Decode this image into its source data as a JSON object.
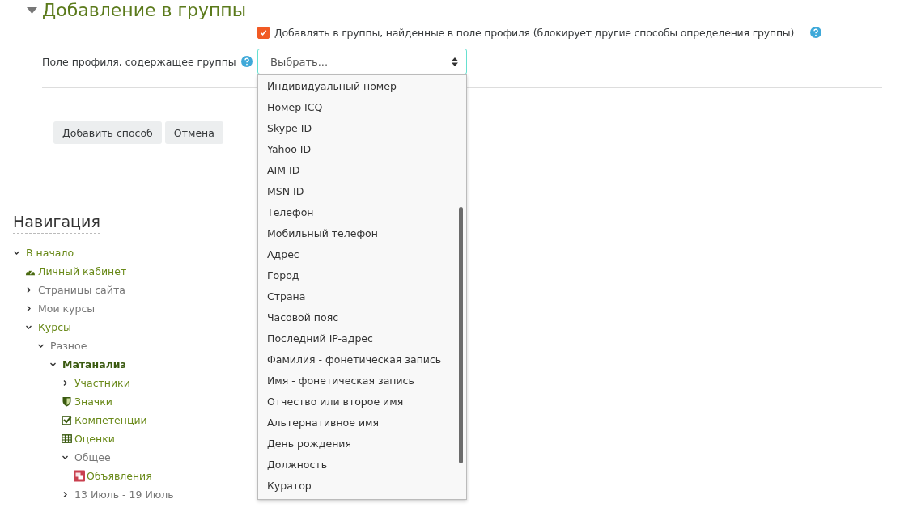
{
  "section": {
    "title": "Добавление в группы",
    "expanded": true
  },
  "checkbox": {
    "label": "Добавлять в группы, найденные в поле профиля (блокирует другие способы определения группы)",
    "checked": true
  },
  "profile_field": {
    "label": "Поле профиля, содержащее группы",
    "value": "Выбрать...",
    "open": true,
    "options": [
      "Индивидуальный номер",
      "Номер ICQ",
      "Skype ID",
      "Yahoo ID",
      "AIM ID",
      "MSN ID",
      "Телефон",
      "Мобильный телефон",
      "Адрес",
      "Город",
      "Страна",
      "Часовой пояс",
      "Последний IP-адрес",
      "Фамилия - фонетическая запись",
      "Имя - фонетическая запись",
      "Отчество или второе имя",
      "Альтернативное имя",
      "День рождения",
      "Должность",
      "Куратор"
    ]
  },
  "buttons": [
    "Добавить способ",
    "Отмена"
  ],
  "navigation": {
    "title": "Навигация",
    "items": [
      {
        "label": "В начало",
        "kind": "expandable",
        "expanded": true,
        "link": true,
        "current": false,
        "children": [
          {
            "label": "Личный кабинет",
            "kind": "dashboard",
            "link": true,
            "current": false
          },
          {
            "label": "Страницы сайта",
            "kind": "expandable",
            "expanded": false,
            "link": false,
            "current": false
          },
          {
            "label": "Мои курсы",
            "kind": "expandable",
            "expanded": false,
            "link": false,
            "current": false
          },
          {
            "label": "Курсы",
            "kind": "expandable",
            "expanded": true,
            "link": true,
            "current": false,
            "children": [
              {
                "label": "Разное",
                "kind": "expandable",
                "expanded": true,
                "link": false,
                "current": false,
                "children": [
                  {
                    "label": "Матанализ",
                    "kind": "expandable",
                    "expanded": true,
                    "link": true,
                    "current": true,
                    "children": [
                      {
                        "label": "Участники",
                        "kind": "expandable",
                        "expanded": false,
                        "link": true,
                        "current": false
                      },
                      {
                        "label": "Значки",
                        "kind": "badge",
                        "link": true,
                        "current": false
                      },
                      {
                        "label": "Компетенции",
                        "kind": "competency",
                        "link": true,
                        "current": false
                      },
                      {
                        "label": "Оценки",
                        "kind": "grades",
                        "link": true,
                        "current": false
                      },
                      {
                        "label": "Общее",
                        "kind": "expandable",
                        "expanded": true,
                        "link": false,
                        "current": false,
                        "children": [
                          {
                            "label": "Объявления",
                            "kind": "forum",
                            "link": true,
                            "current": false
                          }
                        ]
                      },
                      {
                        "label": "13 Июль - 19 Июль",
                        "kind": "expandable",
                        "expanded": false,
                        "link": false,
                        "current": false
                      }
                    ]
                  }
                ]
              }
            ]
          }
        ]
      }
    ]
  }
}
